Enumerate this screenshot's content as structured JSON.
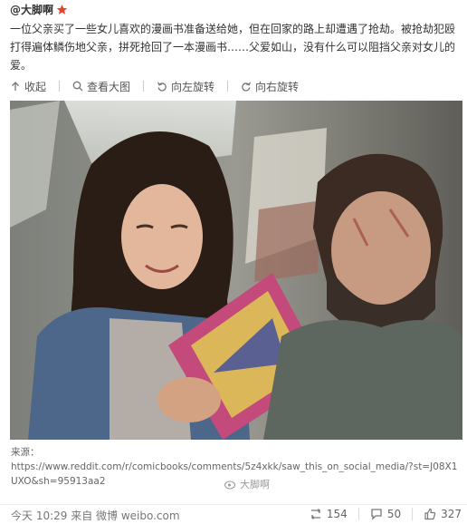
{
  "post": {
    "author": "@大脚啊",
    "text": "一位父亲买了一些女儿喜欢的漫画书准备送给她，但在回家的路上却遭遇了抢劫。被抢劫犯殴打得遍体鳞伤地父亲，拼死抢回了一本漫画书……父爱如山，没有什么可以阻挡父亲对女儿的爱。",
    "toolbar": {
      "collapse": "收起",
      "view_large": "查看大图",
      "rotate_left": "向左旋转",
      "rotate_right": "向右旋转"
    },
    "source_label": "来源：",
    "source_url": "https://www.reddit.com/r/comicbooks/comments/5z4xkk/saw_this_on_social_media/?st=J08X1UXO&sh=95913aa2",
    "watermark": "大脚啊",
    "timestamp": "今天 10:29 来自 微博 weibo.com",
    "counts": {
      "reposts": "154",
      "comments": "50",
      "likes": "327"
    }
  },
  "colors": {
    "accent_star": "#e8412c",
    "text": "#333333",
    "muted": "#777777"
  },
  "icons": [
    "star-icon",
    "collapse-arrow-icon",
    "search-icon",
    "rotate-left-icon",
    "rotate-right-icon",
    "repost-icon",
    "comment-icon",
    "like-icon",
    "weibo-logo-icon"
  ]
}
